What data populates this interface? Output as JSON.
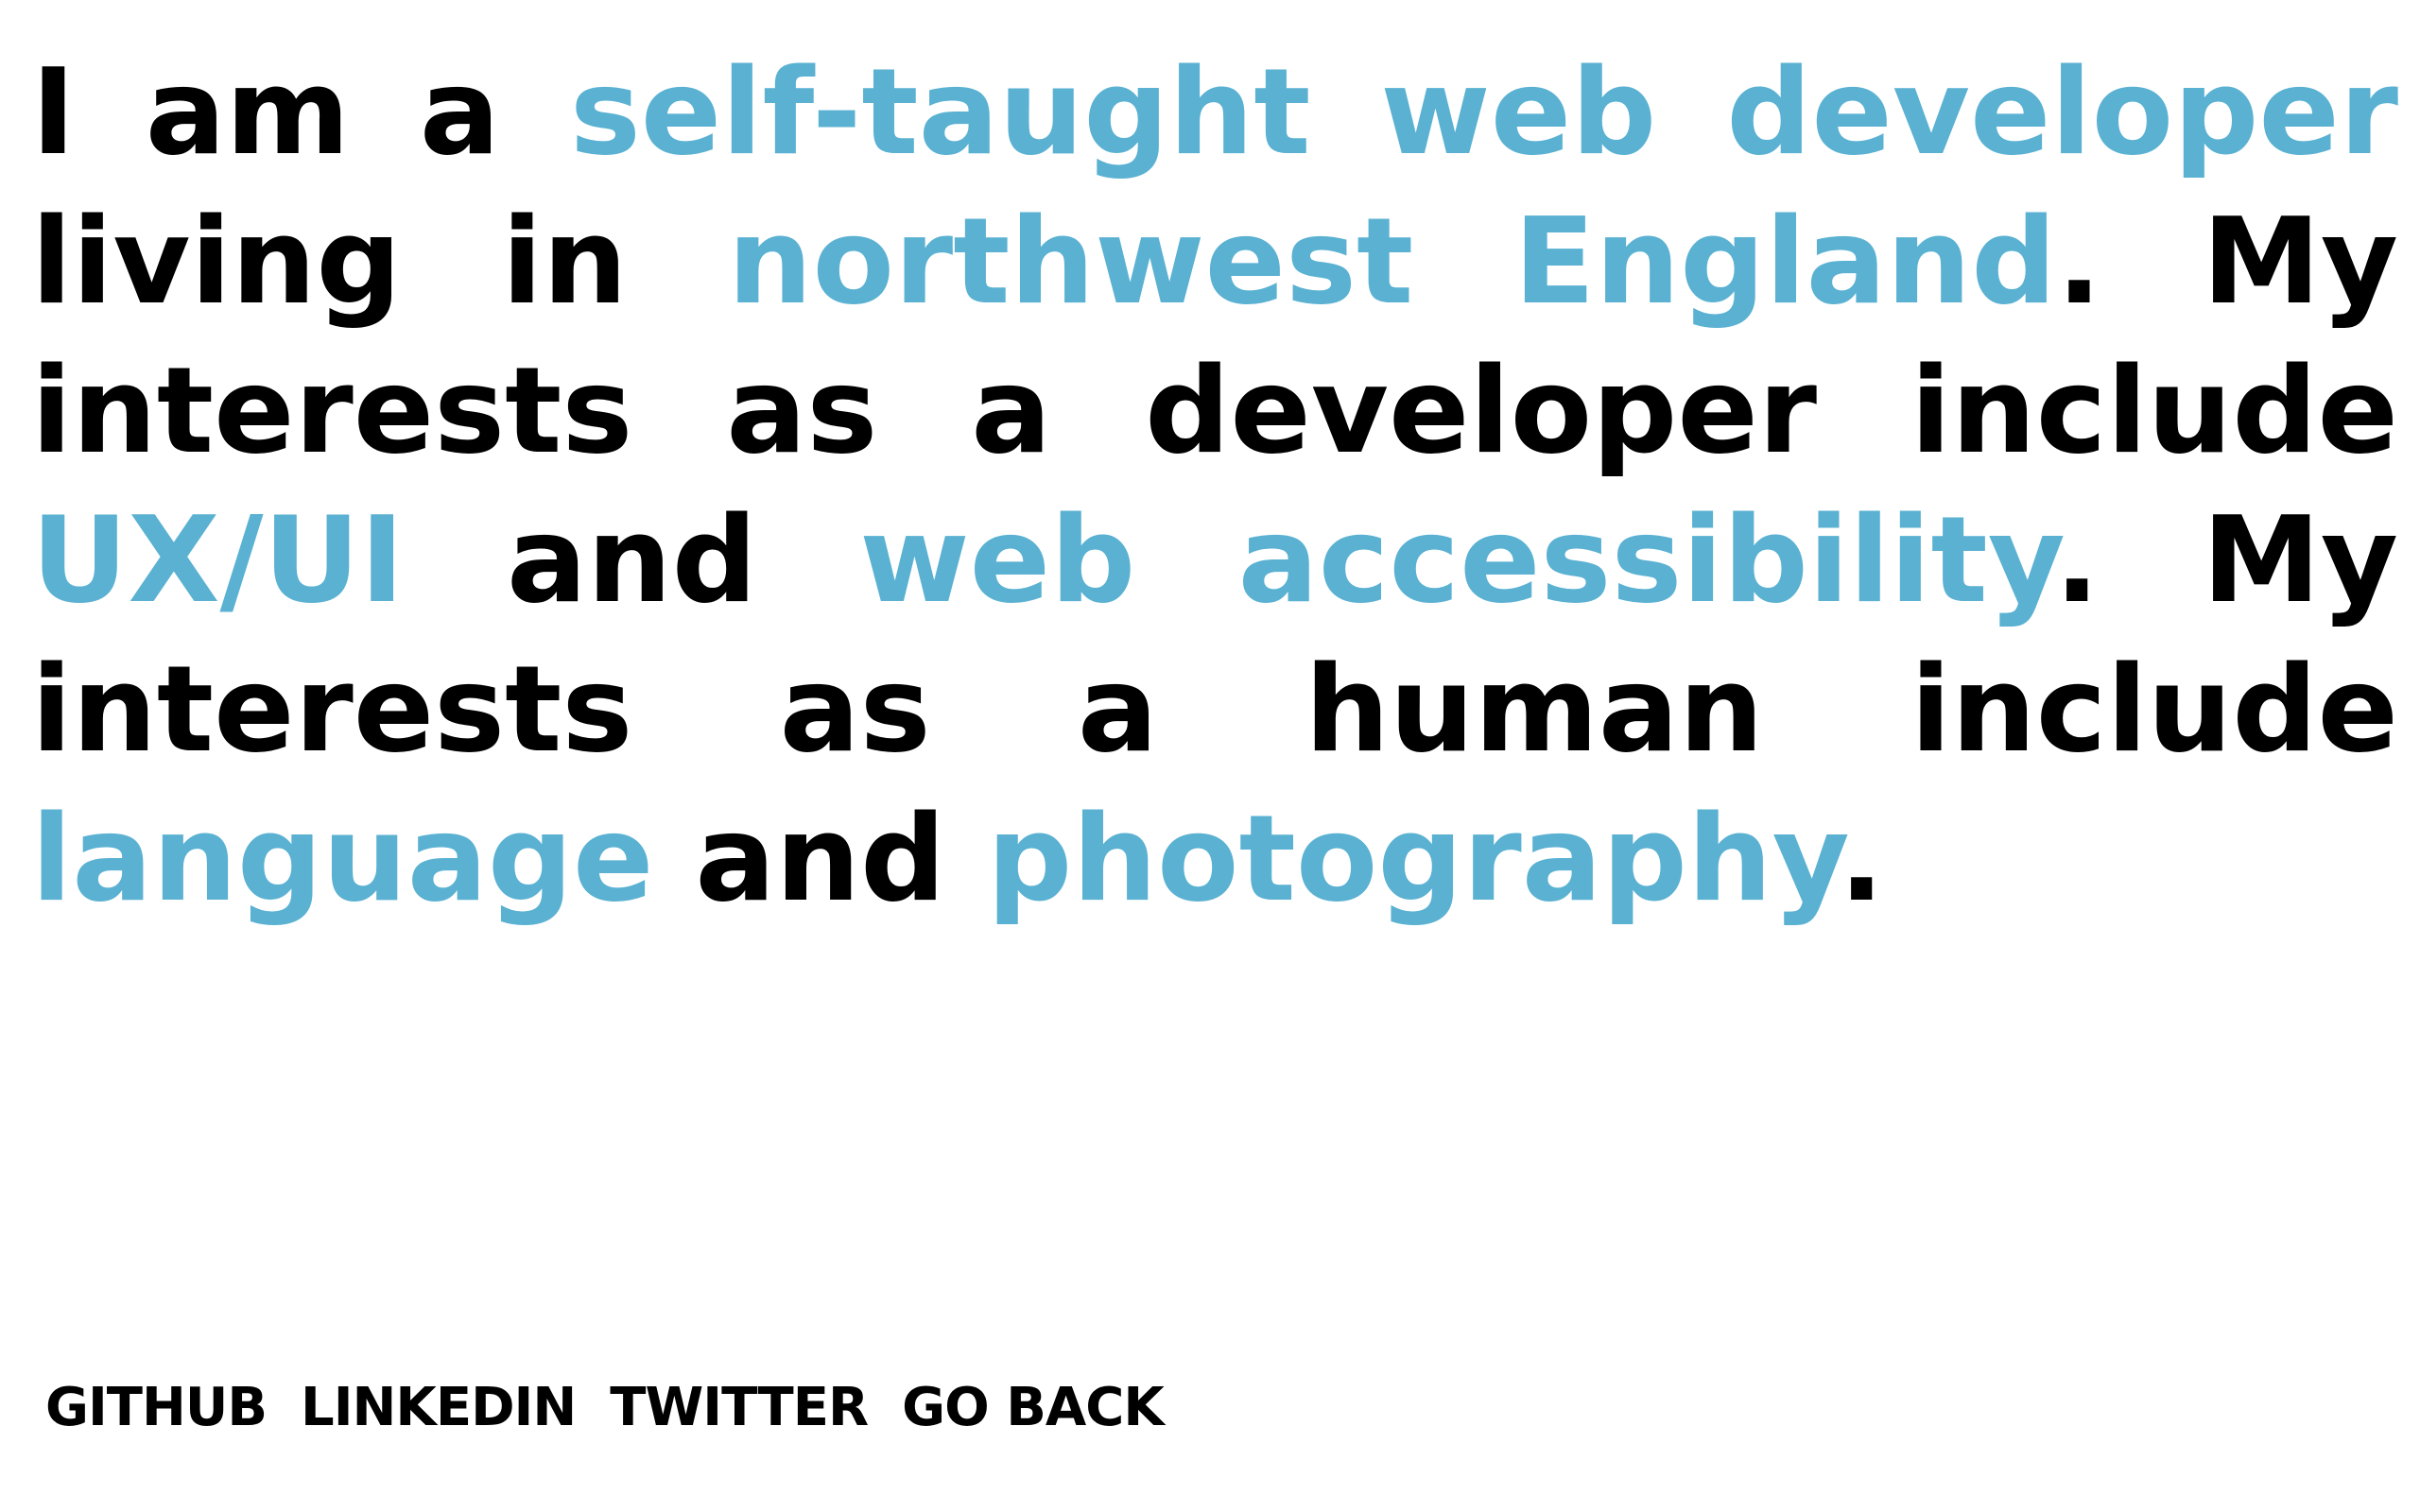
{
  "bio": {
    "s1": "I am a ",
    "h1": "self-taught web developer",
    "s2": " living in ",
    "h2": "northwest England",
    "s3": ". My interests as a developer include ",
    "h3": "UX/UI",
    "s4": " and ",
    "h4": "web accessibility",
    "s5": ". My interests as a human include ",
    "h5": "language",
    "s6": " and ",
    "h6": "photography",
    "s7": "."
  },
  "nav": {
    "github": "GITHUB",
    "linkedin": "LINKEDIN",
    "twitter": "TWITTER",
    "go_back": "GO BACK"
  },
  "colors": {
    "accent": "#5ab1d2",
    "text": "#000000",
    "background": "#ffffff"
  }
}
